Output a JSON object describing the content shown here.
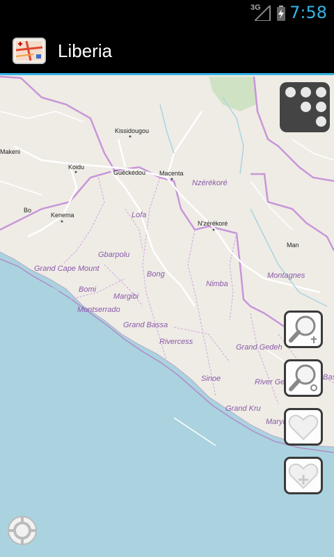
{
  "status_bar": {
    "network": "3G",
    "time": "7:58"
  },
  "action_bar": {
    "title": "Liberia",
    "icon": "map-app-icon"
  },
  "map": {
    "cities": [
      {
        "name": "Makeni"
      },
      {
        "name": "Kissidougou"
      },
      {
        "name": "Koidu"
      },
      {
        "name": "Guéckédou"
      },
      {
        "name": "Macenta"
      },
      {
        "name": "Bo"
      },
      {
        "name": "Kenema"
      },
      {
        "name": "N'zérékoré"
      },
      {
        "name": "Man"
      }
    ],
    "regions": [
      {
        "name": "Nzérékoré"
      },
      {
        "name": "Lofa"
      },
      {
        "name": "Gbarpolu"
      },
      {
        "name": "Grand Cape Mount"
      },
      {
        "name": "Bong"
      },
      {
        "name": "Bomi"
      },
      {
        "name": "Margibi"
      },
      {
        "name": "Montserrado"
      },
      {
        "name": "Nimba"
      },
      {
        "name": "Montagnes"
      },
      {
        "name": "Grand Bassa"
      },
      {
        "name": "Rivercess"
      },
      {
        "name": "Grand Gedeh"
      },
      {
        "name": "Sinoe"
      },
      {
        "name": "River Ge"
      },
      {
        "name": "Bas"
      },
      {
        "name": "Grand Kru"
      },
      {
        "name": "Maryl"
      }
    ]
  },
  "controls": {
    "layers_icon": "dice-layers-icon",
    "zoom_out_icon": "zoom-out-icon",
    "zoom_in_icon": "zoom-in-icon",
    "favorites_icon": "heart-icon",
    "add_favorite_icon": "heart-add-icon",
    "locate_icon": "crosshair-icon"
  }
}
